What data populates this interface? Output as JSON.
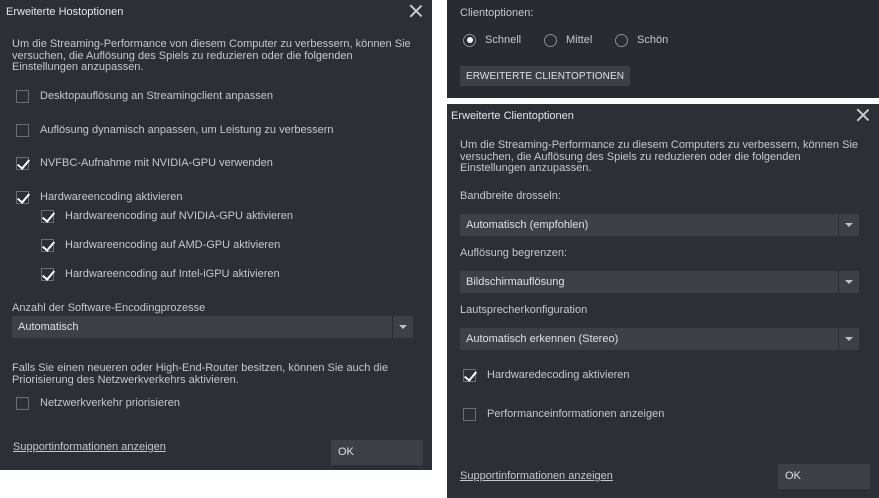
{
  "host_dialog": {
    "title": "Erweiterte Hostoptionen",
    "description_line1": "Um die Streaming-Performance von diesem Computer zu verbessern, können Sie",
    "description_line2": "versuchen, die Auflösung des Spiels zu reduzieren oder die folgenden",
    "description_line3": "Einstellungen anzupassen.",
    "options": [
      {
        "label": "Desktopauflösung an Streamingclient anpassen",
        "checked": false
      },
      {
        "label": "Auflösung dynamisch anpassen, um Leistung zu verbessern",
        "checked": false
      },
      {
        "label": "NVFBC-Aufnahme mit NVIDIA-GPU verwenden",
        "checked": true
      },
      {
        "label": "Hardwareencoding aktivieren",
        "checked": true
      }
    ],
    "sub_options": [
      {
        "label": "Hardwareencoding auf NVIDIA-GPU aktivieren",
        "checked": true
      },
      {
        "label": "Hardwareencoding auf AMD-GPU aktivieren",
        "checked": true
      },
      {
        "label": "Hardwareencoding auf Intel-iGPU aktivieren",
        "checked": true
      }
    ],
    "encoding_label": "Anzahl der Software-Encodingprozesse",
    "encoding_value": "Automatisch",
    "router_line1": "Falls Sie einen neueren oder High-End-Router besitzen, können Sie auch die",
    "router_line2": "Priorisierung des Netzwerkverkehrs aktivieren.",
    "network_option": {
      "label": "Netzwerkverkehr priorisieren",
      "checked": false
    },
    "support_link": "Supportinformationen anzeigen",
    "ok_label": "OK"
  },
  "client_panel": {
    "label": "Clientoptionen:",
    "radios": [
      {
        "label": "Schnell",
        "selected": true
      },
      {
        "label": "Mittel",
        "selected": false
      },
      {
        "label": "Schön",
        "selected": false
      }
    ],
    "advanced_button": "ERWEITERTE CLIENTOPTIONEN"
  },
  "client_dialog": {
    "title": "Erweiterte Clientoptionen",
    "description_line1": "Um die Streaming-Performance zu diesem Computers zu verbessern, können Sie",
    "description_line2": "versuchen, die Auflösung des Spiels zu reduzieren oder die folgenden",
    "description_line3": "Einstellungen anzupassen.",
    "bandwidth_label": "Bandbreite drosseln:",
    "bandwidth_value": "Automatisch (empfohlen)",
    "resolution_label": "Auflösung begrenzen:",
    "resolution_value": "Bildschirmauflösung",
    "speaker_label": "Lautsprecherkonfiguration",
    "speaker_value": "Automatisch erkennen (Stereo)",
    "options": [
      {
        "label": "Hardwaredecoding aktivieren",
        "checked": true
      },
      {
        "label": "Performanceinformationen anzeigen",
        "checked": false
      }
    ],
    "support_link": "Supportinformationen anzeigen",
    "ok_label": "OK"
  }
}
